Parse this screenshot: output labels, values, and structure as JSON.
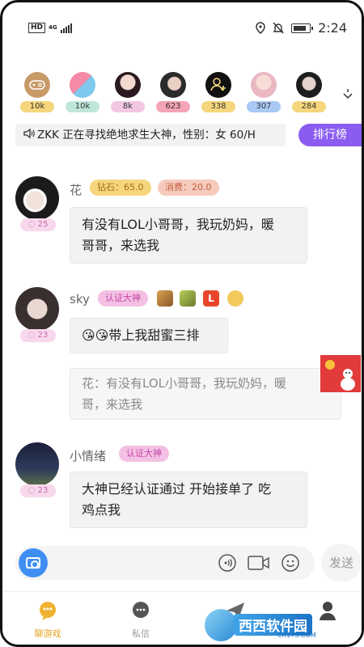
{
  "status_bar": {
    "hd": "HD",
    "network": "4G",
    "time": "2:24"
  },
  "avatars": [
    {
      "badge": "10k",
      "badge_color": "#f5d67c",
      "icon": "game-controller-icon"
    },
    {
      "badge": "10k",
      "badge_color": "#bfe7d9",
      "icon": "avatar"
    },
    {
      "badge": "8k",
      "badge_color": "#f2c7e4",
      "icon": "avatar"
    },
    {
      "badge": "623",
      "badge_color": "#f5a3b6",
      "icon": "avatar"
    },
    {
      "badge": "338",
      "badge_color": "#f5d67c",
      "icon": "add-user-icon"
    },
    {
      "badge": "307",
      "badge_color": "#a9c8f4",
      "icon": "avatar"
    },
    {
      "badge": "284",
      "badge_color": "#f5d67c",
      "icon": "avatar"
    }
  ],
  "notice": {
    "text": "ZKK 正在寻找绝地求生大神，性别：女 60/H"
  },
  "rank_button": "排行榜",
  "messages": [
    {
      "name": "花",
      "count": "25",
      "tags": [
        "钻石：65.0",
        "消费：20.0"
      ],
      "lines": [
        "有没有LOL小哥哥，我玩奶妈，暖",
        "哥哥，来选我"
      ]
    },
    {
      "name": "sky",
      "count": "23",
      "tags": [
        "认证大神"
      ],
      "text": "😘😘带上我甜蜜三排",
      "quote_lines": [
        "花：有没有LOL小哥哥，我玩奶妈，暖",
        "哥，来选我"
      ]
    },
    {
      "name": "小情绪",
      "count": "23",
      "tags": [
        "认证大神"
      ],
      "lines": [
        "大神已经认证通过 开始接单了 吃",
        "鸡点我"
      ]
    }
  ],
  "input": {
    "send_label": "发送"
  },
  "tabs": [
    {
      "label": "聊游戏",
      "active": true
    },
    {
      "label": "私信",
      "active": false
    }
  ],
  "watermark": {
    "text": "西西软件园",
    "sub": "CR173.COM"
  },
  "colors": {
    "accent": "#8a5cf0",
    "active_tab": "#e5a41e",
    "camera": "#3f8ff3"
  }
}
